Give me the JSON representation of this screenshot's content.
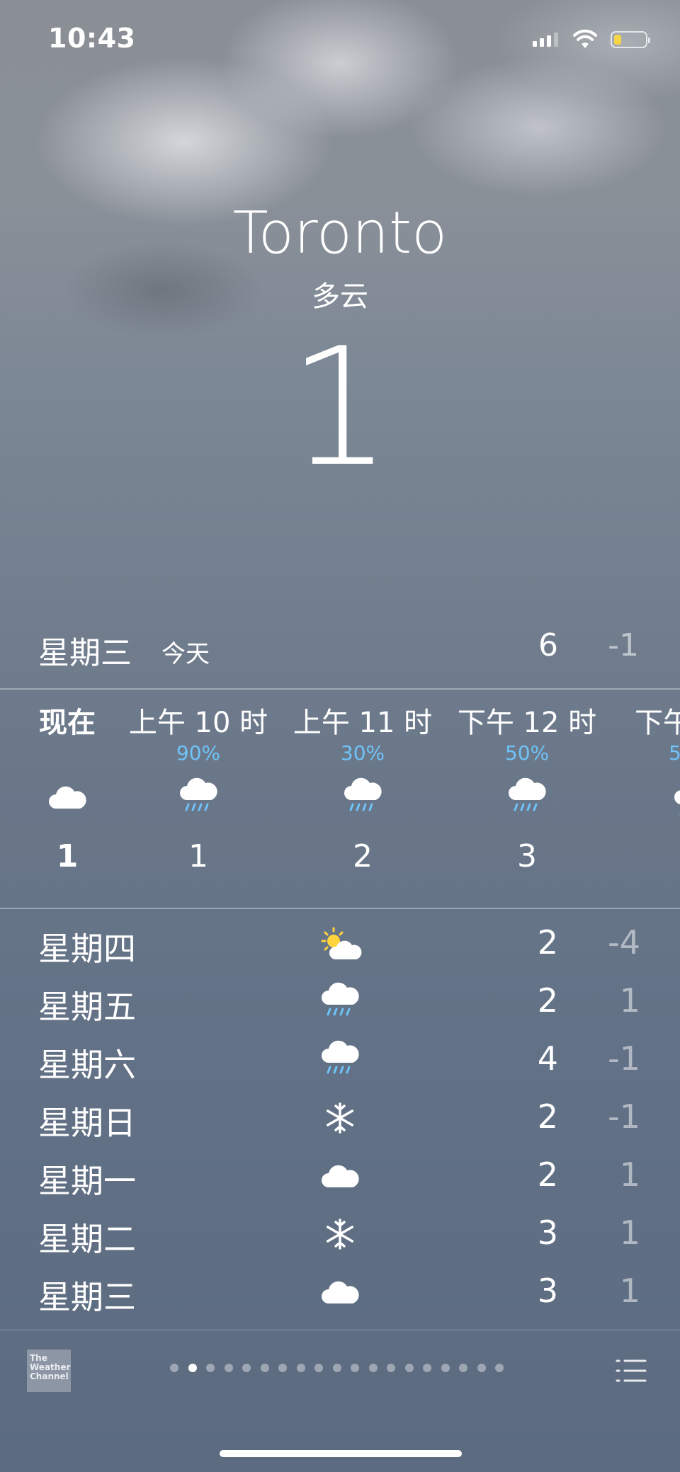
{
  "status_bar": {
    "time": "10:43",
    "battery_color": "#f5d547"
  },
  "location": {
    "city": "Toronto",
    "condition": "多云",
    "temperature": "1"
  },
  "today": {
    "day": "星期三",
    "label": "今天",
    "high": "6",
    "low": "-1"
  },
  "hourly": [
    {
      "label": "现在",
      "pop": "",
      "icon": "cloud-icon",
      "temp": "1"
    },
    {
      "label": "上午 10 时",
      "pop": "90%",
      "icon": "rain-icon",
      "temp": "1"
    },
    {
      "label": "上午 11 时",
      "pop": "30%",
      "icon": "rain-icon",
      "temp": "2"
    },
    {
      "label": "下午 12 时",
      "pop": "50%",
      "icon": "rain-icon",
      "temp": "3"
    },
    {
      "label": "下午",
      "pop": "5",
      "icon": "rain-icon",
      "temp": ""
    }
  ],
  "daily": [
    {
      "day": "星期四",
      "icon": "partly-sunny-icon",
      "high": "2",
      "low": "-4"
    },
    {
      "day": "星期五",
      "icon": "rain-icon",
      "high": "2",
      "low": "1"
    },
    {
      "day": "星期六",
      "icon": "rain-icon",
      "high": "4",
      "low": "-1"
    },
    {
      "day": "星期日",
      "icon": "snowflake-icon",
      "high": "2",
      "low": "-1"
    },
    {
      "day": "星期一",
      "icon": "cloud-icon",
      "high": "2",
      "low": "1"
    },
    {
      "day": "星期二",
      "icon": "snowflake-icon",
      "high": "3",
      "low": "1"
    },
    {
      "day": "星期三",
      "icon": "cloud-icon",
      "high": "3",
      "low": "1"
    }
  ],
  "footer": {
    "logo_lines": [
      "The",
      "Weather",
      "Channel"
    ],
    "page_count": 19,
    "active_page": 1,
    "pop_color": "#6fc3f7"
  }
}
